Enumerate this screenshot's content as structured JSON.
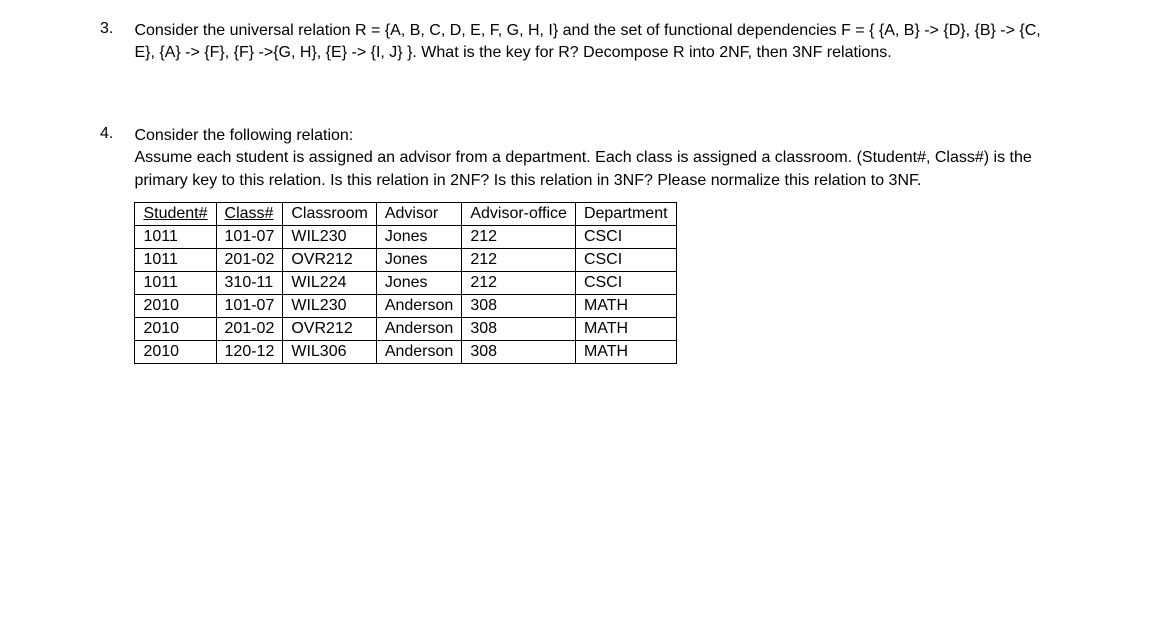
{
  "questions": [
    {
      "number": "3.",
      "text": "Consider the universal relation R = {A, B, C, D, E, F, G, H, I} and the set of functional dependencies F = { {A, B} -> {D}, {B} -> {C, E}, {A} -> {F}, {F} ->{G, H}, {E} -> {I, J} }. What is the key for R? Decompose R into 2NF, then 3NF relations."
    },
    {
      "number": "4.",
      "text": "Consider the following relation:\nAssume each student is assigned an advisor from a department.  Each class is assigned a classroom. (Student#, Class#) is the primary key to this relation. Is this relation in 2NF? Is this relation in 3NF? Please normalize this relation to 3NF."
    }
  ],
  "table": {
    "headers": [
      "Student#",
      "Class#",
      "Classroom",
      "Advisor",
      "Advisor-office",
      "Department"
    ],
    "underlined_headers": [
      0,
      1
    ],
    "rows": [
      [
        "1011",
        "101-07",
        "WIL230",
        "Jones",
        "212",
        "CSCI"
      ],
      [
        "1011",
        "201-02",
        "OVR212",
        "Jones",
        "212",
        "CSCI"
      ],
      [
        "1011",
        "310-11",
        "WIL224",
        "Jones",
        "212",
        "CSCI"
      ],
      [
        "2010",
        "101-07",
        "WIL230",
        "Anderson",
        "308",
        "MATH"
      ],
      [
        "2010",
        "201-02",
        "OVR212",
        "Anderson",
        "308",
        "MATH"
      ],
      [
        "2010",
        "120-12",
        "WIL306",
        "Anderson",
        "308",
        "MATH"
      ]
    ]
  }
}
